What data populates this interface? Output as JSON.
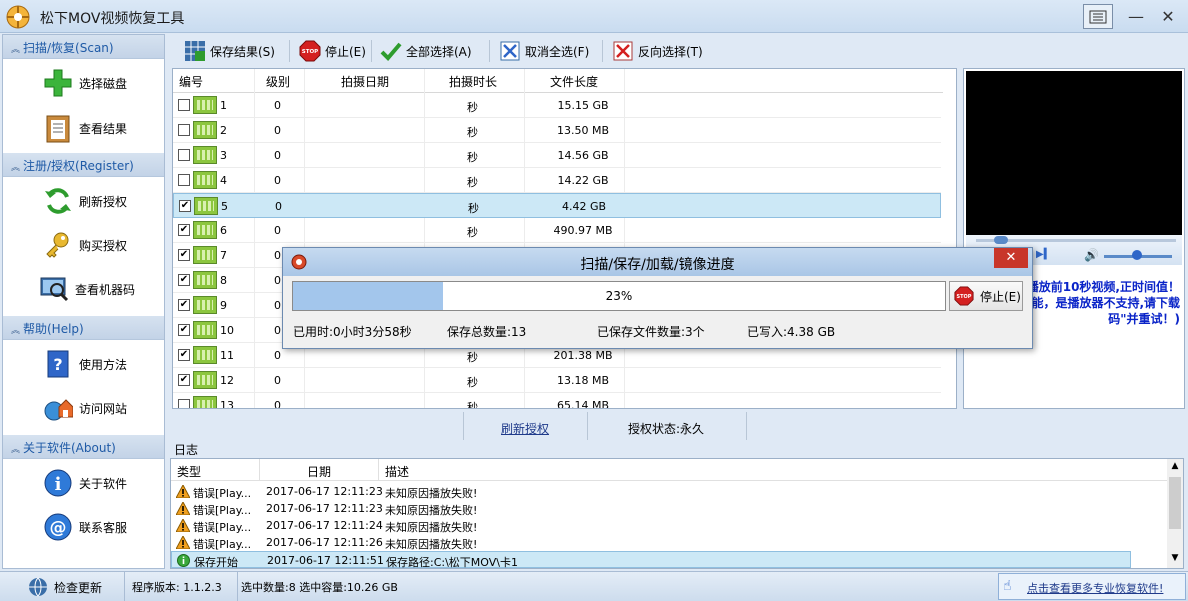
{
  "app": {
    "title": "松下MOV视频恢复工具"
  },
  "sidebar": {
    "sections": [
      {
        "header": "扫描/恢复(Scan)",
        "items": [
          {
            "label": "选择磁盘",
            "icon": "plus-icon"
          },
          {
            "label": "查看结果",
            "icon": "clipboard-icon"
          }
        ]
      },
      {
        "header": "注册/授权(Register)",
        "items": [
          {
            "label": "刷新授权",
            "icon": "refresh-icon"
          },
          {
            "label": "购买授权",
            "icon": "key-icon"
          },
          {
            "label": "查看机器码",
            "icon": "monitor-search-icon"
          }
        ]
      },
      {
        "header": "帮助(Help)",
        "items": [
          {
            "label": "使用方法",
            "icon": "help-book-icon"
          },
          {
            "label": "访问网站",
            "icon": "home-globe-icon"
          }
        ]
      },
      {
        "header": "关于软件(About)",
        "items": [
          {
            "label": "关于软件",
            "icon": "info-icon"
          },
          {
            "label": "联系客服",
            "icon": "at-icon"
          }
        ]
      }
    ]
  },
  "toolbar": {
    "save": "保存结果(S)",
    "stop": "停止(E)",
    "select_all": "全部选择(A)",
    "deselect_all": "取消全选(F)",
    "invert": "反向选择(T)"
  },
  "filelist": {
    "columns": [
      "编号",
      "级别",
      "拍摄日期",
      "拍摄时长",
      "文件长度"
    ],
    "rows": [
      {
        "id": "1",
        "level": "0",
        "date": "",
        "duration": "秒",
        "size": "15.15 GB",
        "checked": "",
        "sel": false
      },
      {
        "id": "2",
        "level": "0",
        "date": "",
        "duration": "秒",
        "size": "13.50 MB",
        "checked": "",
        "sel": false
      },
      {
        "id": "3",
        "level": "0",
        "date": "",
        "duration": "秒",
        "size": "14.56 GB",
        "checked": "",
        "sel": false
      },
      {
        "id": "4",
        "level": "0",
        "date": "",
        "duration": "秒",
        "size": "14.22 GB",
        "checked": "",
        "sel": false
      },
      {
        "id": "5",
        "level": "0",
        "date": "",
        "duration": "秒",
        "size": "4.42 GB",
        "checked": "✔",
        "sel": true
      },
      {
        "id": "6",
        "level": "0",
        "date": "",
        "duration": "秒",
        "size": "490.97 MB",
        "checked": "✔",
        "sel": false
      },
      {
        "id": "7",
        "level": "0",
        "date": "",
        "duration": "",
        "size": "",
        "checked": "✔",
        "sel": false
      },
      {
        "id": "8",
        "level": "0",
        "date": "",
        "duration": "",
        "size": "",
        "checked": "✔",
        "sel": false
      },
      {
        "id": "9",
        "level": "0",
        "date": "",
        "duration": "",
        "size": "",
        "checked": "✔",
        "sel": false
      },
      {
        "id": "10",
        "level": "0",
        "date": "",
        "duration": "",
        "size": "",
        "checked": "✔",
        "sel": false
      },
      {
        "id": "11",
        "level": "0",
        "date": "",
        "duration": "秒",
        "size": "201.38 MB",
        "checked": "✔",
        "sel": false
      },
      {
        "id": "12",
        "level": "0",
        "date": "",
        "duration": "秒",
        "size": "13.18 MB",
        "checked": "✔",
        "sel": false
      },
      {
        "id": "13",
        "level": "0",
        "date": "",
        "duration": "秒",
        "size": "65.14 MB",
        "checked": "",
        "sel": false
      }
    ]
  },
  "player": {
    "notice": "播放仅能播放前10秒视频,正时间值！(如果遇到不能，是播放器不支持,请下载码\"并重试！)"
  },
  "status": {
    "refresh_link": "刷新授权",
    "license_state": "授权状态:永久"
  },
  "log": {
    "label": "日志",
    "columns": [
      "类型",
      "日期",
      "描述"
    ],
    "rows": [
      {
        "type": "错误[Play...",
        "date": "2017-06-17 12:11:23",
        "desc": "未知原因播放失败!",
        "icon": "warning-icon",
        "sel": false
      },
      {
        "type": "错误[Play...",
        "date": "2017-06-17 12:11:23",
        "desc": "未知原因播放失败!",
        "icon": "warning-icon",
        "sel": false
      },
      {
        "type": "错误[Play...",
        "date": "2017-06-17 12:11:24",
        "desc": "未知原因播放失败!",
        "icon": "warning-icon",
        "sel": false
      },
      {
        "type": "错误[Play...",
        "date": "2017-06-17 12:11:26",
        "desc": "未知原因播放失败!",
        "icon": "warning-icon",
        "sel": false
      },
      {
        "type": "保存开始",
        "date": "2017-06-17 12:11:51",
        "desc": "保存路径:C:\\松下MOV\\卡1",
        "icon": "info-green-icon",
        "sel": true
      }
    ]
  },
  "bottom": {
    "check_update": "检查更新",
    "version": "程序版本:  1.1.2.3",
    "selection": "选中数量:8 选中容量:10.26 GB",
    "more_link": "点击查看更多专业恢复软件!"
  },
  "dialog": {
    "title": "扫描/保存/加载/镜像进度",
    "progress": 23,
    "progress_text": "23%",
    "stop": "停止(E)",
    "elapsed": "已用时:0小时3分58秒",
    "total": "保存总数量:13",
    "saved": "已保存文件数量:3个",
    "written": "已写入:4.38 GB"
  },
  "colors": {
    "accent": "#1f5aa6",
    "progress": "#a3c6ec",
    "selection": "#cce8f6",
    "notice": "#0a24c8"
  }
}
